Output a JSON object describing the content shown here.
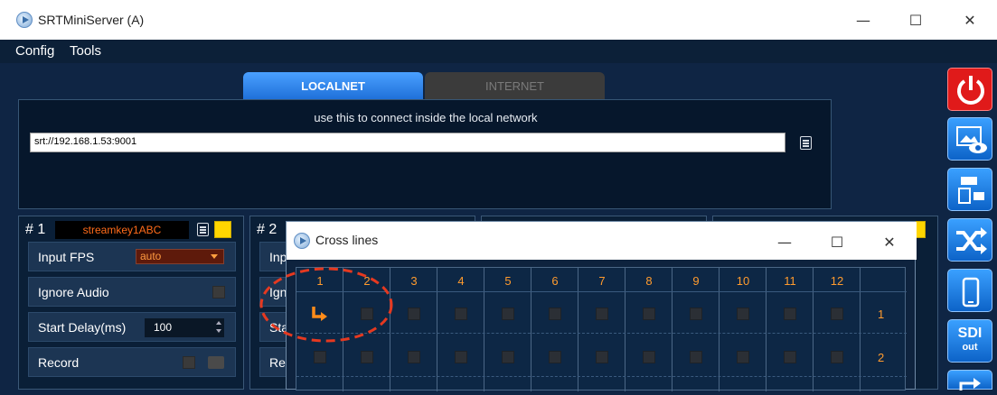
{
  "window": {
    "title": "SRTMiniServer (A)",
    "controls": [
      "—",
      "☐",
      "✕"
    ]
  },
  "menu": {
    "items": [
      "Config",
      "Tools"
    ]
  },
  "tabs": {
    "localnet": "LOCALNET",
    "internet": "INTERNET",
    "active": "localnet"
  },
  "connection": {
    "hint": "use this to connect inside the local network",
    "url": "srt://192.168.1.53:9001"
  },
  "panels": [
    {
      "number": "# 1",
      "key": "streamkey1ABC",
      "rows": {
        "fps_label": "Input FPS",
        "fps_value": "auto",
        "ignore_label": "Ignore Audio",
        "delay_label": "Start Delay(ms)",
        "delay_value": "100",
        "record_label": "Record"
      }
    },
    {
      "number": "# 2",
      "rows": {
        "fps_label": "Inp",
        "ignore_label": "Ign",
        "delay_label": "Sta",
        "record_label": "Re"
      }
    }
  ],
  "sidebar": {
    "sdi_top": "SDI",
    "sdi_bottom": "out"
  },
  "cross_lines": {
    "title": "Cross lines",
    "columns": [
      "1",
      "2",
      "3",
      "4",
      "5",
      "6",
      "7",
      "8",
      "9",
      "10",
      "11",
      "12"
    ],
    "rows": [
      "1",
      "2"
    ],
    "routed": "row 1 → column 1"
  },
  "colors": {
    "accent_blue": "#1e6fd8",
    "orange": "#ff9b2e",
    "key_orange": "#ff6b1a",
    "power_red": "#e01a1a",
    "highlight_ring": "#e53920",
    "background": "#0f2544"
  }
}
